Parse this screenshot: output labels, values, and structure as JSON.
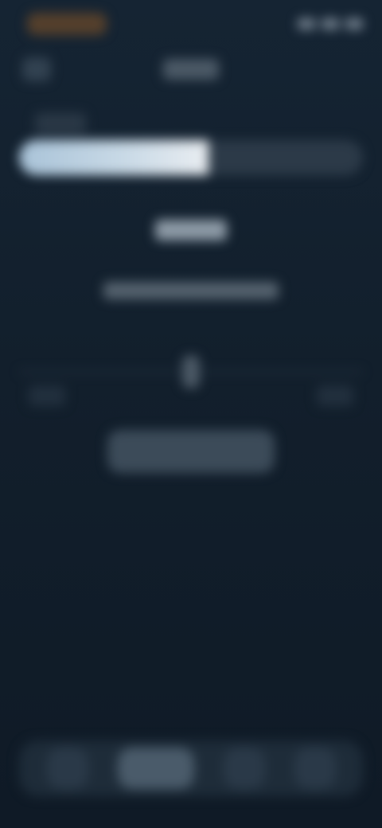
{
  "status_bar": {
    "time": "",
    "icons": [
      "signal-icon",
      "wifi-icon",
      "battery-icon"
    ]
  },
  "header": {
    "title": ""
  },
  "meter": {
    "label": "",
    "fill_fraction": 0.55
  },
  "center": {
    "title": "",
    "subtitle": ""
  },
  "primary_button": {
    "label": ""
  },
  "bottom_nav": {
    "items": [
      {
        "icon": "home-icon"
      },
      {
        "icon": "search-icon"
      },
      {
        "icon": "chat-icon"
      },
      {
        "icon": "profile-icon"
      }
    ]
  },
  "colors": {
    "background": "#121f2c",
    "meter_start": "#a9c3d8",
    "meter_end": "#e9edf1",
    "accent_status": "#d8a460"
  }
}
